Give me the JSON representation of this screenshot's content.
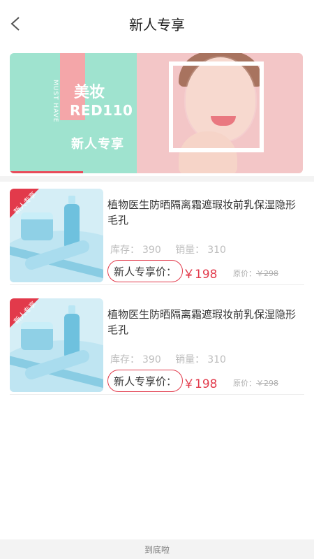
{
  "header": {
    "title": "新人专享",
    "back_icon": "chevron-left-icon"
  },
  "banner": {
    "must_have": "MUST HAVE",
    "meizhuang": "美妆",
    "code": "RED110",
    "label": "新人专享",
    "colors": {
      "mint": "#9fe3cf",
      "pink": "#f4a6a9",
      "right_bg": "#f3c6c7",
      "accent": "#e94b5a"
    }
  },
  "products": [
    {
      "tag": "新人专享",
      "name": "植物医生防晒隔离霜遮瑕妆前乳保湿隐形毛孔",
      "stock_label": "库存：",
      "stock": "390",
      "sales_label": "销量：",
      "sales": "310",
      "promo_label": "新人专享价：",
      "price": "￥198",
      "orig_label": "原价：",
      "orig_price": "￥298"
    },
    {
      "tag": "新人专享",
      "name": "植物医生防晒隔离霜遮瑕妆前乳保湿隐形毛孔",
      "stock_label": "库存：",
      "stock": "390",
      "sales_label": "销量：",
      "sales": "310",
      "promo_label": "新人专享价：",
      "price": "￥198",
      "orig_label": "原价：",
      "orig_price": "￥298"
    }
  ],
  "footer": {
    "text": "到底啦"
  },
  "colors": {
    "accent": "#e23a4b",
    "muted": "#bdbdbd"
  }
}
